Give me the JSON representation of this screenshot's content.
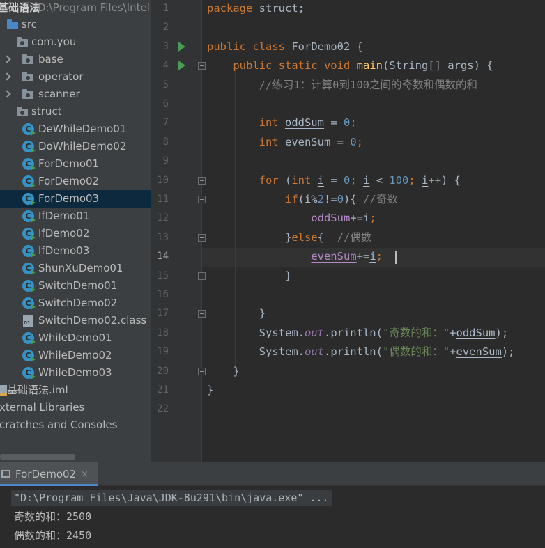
{
  "project_header": {
    "title": "基础语法",
    "path": "D:\\Program Files\\Intell"
  },
  "tree": [
    {
      "label": "src",
      "kind": "folder-src",
      "expanded": true
    },
    {
      "label": "com.you",
      "kind": "package",
      "expanded": true
    },
    {
      "label": "base",
      "kind": "package",
      "expanded": false
    },
    {
      "label": "operator",
      "kind": "package",
      "expanded": false
    },
    {
      "label": "scanner",
      "kind": "package",
      "expanded": false
    },
    {
      "label": "struct",
      "kind": "package",
      "expanded": true
    },
    {
      "label": "DeWhileDemo01",
      "kind": "class"
    },
    {
      "label": "DoWhileDemo02",
      "kind": "class"
    },
    {
      "label": "ForDemo01",
      "kind": "class"
    },
    {
      "label": "ForDemo02",
      "kind": "class"
    },
    {
      "label": "ForDemo03",
      "kind": "class",
      "selected": true
    },
    {
      "label": "IfDemo01",
      "kind": "class"
    },
    {
      "label": "IfDemo02",
      "kind": "class"
    },
    {
      "label": "IfDemo03",
      "kind": "class"
    },
    {
      "label": "ShunXuDemo01",
      "kind": "class"
    },
    {
      "label": "SwitchDemo01",
      "kind": "class"
    },
    {
      "label": "SwitchDemo02",
      "kind": "class"
    },
    {
      "label": "SwitchDemo02.class",
      "kind": "classfile"
    },
    {
      "label": "WhileDemo01",
      "kind": "class"
    },
    {
      "label": "WhileDemo02",
      "kind": "class"
    },
    {
      "label": "WhileDemo03",
      "kind": "class"
    },
    {
      "label": "基础语法.iml",
      "kind": "iml"
    },
    {
      "label": "xternal Libraries",
      "kind": "text"
    },
    {
      "label": "cratches and Consoles",
      "kind": "text"
    }
  ],
  "editor": {
    "current_line": 14,
    "line_numbers": [
      "1",
      "2",
      "3",
      "4",
      "5",
      "6",
      "7",
      "8",
      "9",
      "10",
      "11",
      "12",
      "13",
      "14",
      "15",
      "16",
      "17",
      "18",
      "19",
      "20",
      "21",
      "22"
    ],
    "lines": [
      [
        [
          "kw",
          "package "
        ],
        [
          "p",
          "struct;"
        ]
      ],
      [],
      [
        [
          "kw",
          "public class "
        ],
        [
          "p",
          "ForDemo02 {"
        ]
      ],
      [
        [
          "p",
          "    "
        ],
        [
          "kw",
          "public static void "
        ],
        [
          "fn",
          "main"
        ],
        [
          "p",
          "(String[] args) {"
        ]
      ],
      [
        [
          "p",
          "        "
        ],
        [
          "cmt",
          "//练习1：计算0到100之间的奇数和偶数的和"
        ]
      ],
      [],
      [
        [
          "p",
          "        "
        ],
        [
          "kw",
          "int "
        ],
        [
          "var",
          "oddSum"
        ],
        [
          "p",
          " = "
        ],
        [
          "num",
          "0"
        ],
        [
          "kw",
          ";"
        ]
      ],
      [
        [
          "p",
          "        "
        ],
        [
          "kw",
          "int "
        ],
        [
          "var",
          "evenSum"
        ],
        [
          "p",
          " = "
        ],
        [
          "num",
          "0"
        ],
        [
          "kw",
          ";"
        ]
      ],
      [],
      [
        [
          "p",
          "        "
        ],
        [
          "kw",
          "for "
        ],
        [
          "p",
          "("
        ],
        [
          "kw",
          "int "
        ],
        [
          "var",
          "i"
        ],
        [
          "p",
          " = "
        ],
        [
          "num",
          "0"
        ],
        [
          "kw",
          "; "
        ],
        [
          "var",
          "i"
        ],
        [
          "p",
          " < "
        ],
        [
          "num",
          "100"
        ],
        [
          "kw",
          "; "
        ],
        [
          "var",
          "i"
        ],
        [
          "p",
          "++) {"
        ]
      ],
      [
        [
          "p",
          "            "
        ],
        [
          "kw",
          "if"
        ],
        [
          "p",
          "("
        ],
        [
          "var",
          "i"
        ],
        [
          "p",
          "%"
        ],
        [
          "num",
          "2"
        ],
        [
          "p",
          "!="
        ],
        [
          "num",
          "0"
        ],
        [
          "p",
          "){ "
        ],
        [
          "cmt",
          "//奇数"
        ]
      ],
      [
        [
          "p",
          "                "
        ],
        [
          "mod",
          "oddSum"
        ],
        [
          "p",
          "+="
        ],
        [
          "var",
          "i"
        ],
        [
          "kw",
          ";"
        ]
      ],
      [
        [
          "p",
          "            }"
        ],
        [
          "kw",
          "else"
        ],
        [
          "p",
          "{  "
        ],
        [
          "cmt",
          "//偶数"
        ]
      ],
      [
        [
          "p",
          "                "
        ],
        [
          "mod",
          "evenSum"
        ],
        [
          "p",
          "+="
        ],
        [
          "var",
          "i"
        ],
        [
          "kw",
          ";"
        ]
      ],
      [
        [
          "p",
          "            }"
        ]
      ],
      [],
      [
        [
          "p",
          "        }"
        ]
      ],
      [
        [
          "p",
          "        System."
        ],
        [
          "fld",
          "out"
        ],
        [
          "p",
          ".println("
        ],
        [
          "str",
          "\"奇数的和：\""
        ],
        [
          "p",
          "+"
        ],
        [
          "var",
          "oddSum"
        ],
        [
          "p",
          ");"
        ]
      ],
      [
        [
          "p",
          "        System."
        ],
        [
          "fld",
          "out"
        ],
        [
          "p",
          ".println("
        ],
        [
          "str",
          "\"偶数的和：\""
        ],
        [
          "p",
          "+"
        ],
        [
          "var",
          "evenSum"
        ],
        [
          "p",
          ");"
        ]
      ],
      [
        [
          "p",
          "    }"
        ]
      ],
      [
        [
          "p",
          "}"
        ]
      ],
      []
    ]
  },
  "run_panel": {
    "tab_label": "ForDemo02",
    "close_glyph": "×",
    "console": [
      "\"D:\\Program Files\\Java\\JDK-8u291\\bin\\java.exe\" ...",
      "奇数的和：2500",
      "偶数的和：2450"
    ]
  },
  "colors": {
    "keyword": "#cc7832",
    "number": "#6897bb",
    "string": "#6a8759",
    "comment": "#808080",
    "method": "#ffc66d",
    "static_field": "#9876aa",
    "selection": "#0d293e",
    "run_icon": "#499c54"
  }
}
